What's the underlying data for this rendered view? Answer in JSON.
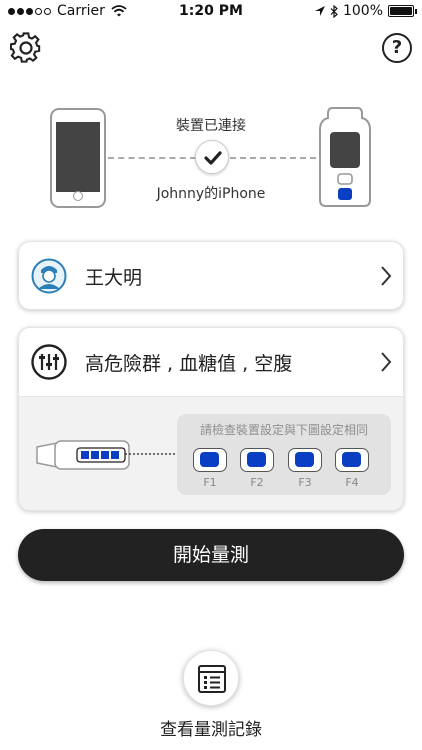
{
  "status_bar": {
    "carrier": "Carrier",
    "time": "1:20 PM",
    "battery": "100%"
  },
  "connection": {
    "status": "裝置已連接",
    "device_name": "Johnny的iPhone"
  },
  "user": {
    "name": "王大明"
  },
  "mode": {
    "label": "高危險群 , 血糖值 , 空腹",
    "hint": "請檢查裝置設定與下圖設定相同",
    "switches": [
      "F1",
      "F2",
      "F3",
      "F4"
    ]
  },
  "start_button": "開始量測",
  "records_label": "查看量測記錄",
  "colors": {
    "accent_blue": "#0a3fc4",
    "button_dark": "#222222",
    "avatar_blue": "#2b7fb8"
  }
}
